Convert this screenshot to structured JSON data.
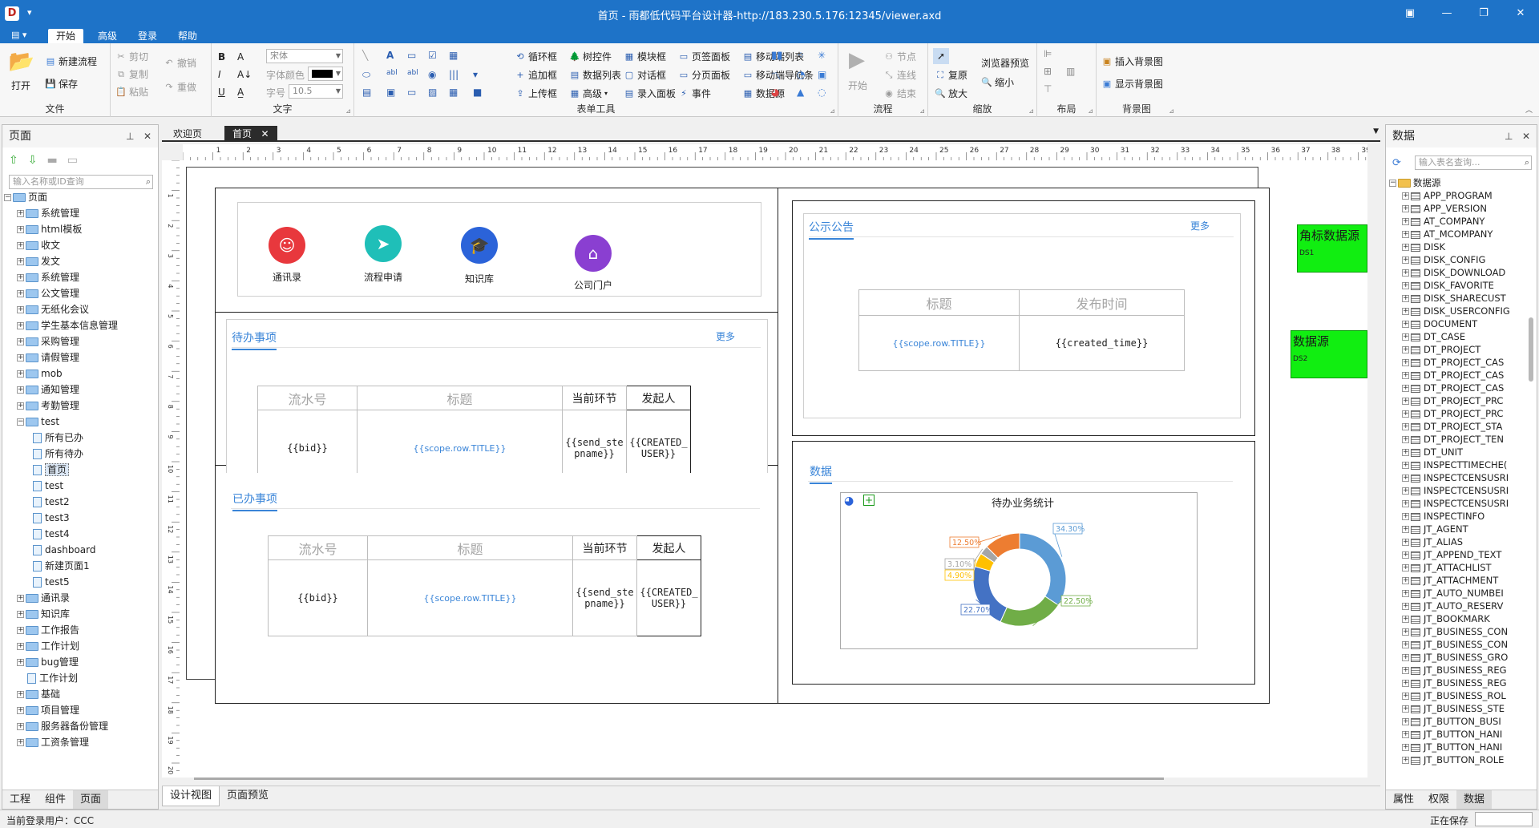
{
  "window": {
    "title": "首页 - 雨都低代码平台设计器-http://183.230.5.176:12345/viewer.axd",
    "app_icon": "D",
    "quick_access": "▾",
    "controls": [
      "▣",
      "—",
      "❐",
      "✕"
    ]
  },
  "menu": {
    "items": [
      "开始",
      "高级",
      "登录",
      "帮助"
    ],
    "active": "开始"
  },
  "ribbon": {
    "file": {
      "label": "文件",
      "open": "打开",
      "new_flow": "新建流程",
      "save": "保存"
    },
    "clipboard": {
      "cut": "剪切",
      "undo": "撤销",
      "copy": "复制",
      "paste": "粘贴",
      "redo": "重做"
    },
    "text": {
      "label": "文字",
      "font": "宋体",
      "font_color": "字体颜色",
      "font_size_label": "字号",
      "font_size": "10.5",
      "B": "B",
      "I": "I",
      "U": "U",
      "A": "A"
    },
    "form_tools": {
      "label": "表单工具",
      "items": [
        [
          "循环框",
          "树控件",
          "模块框",
          "页签面板",
          "移动端列表"
        ],
        [
          "追加框",
          "数据列表",
          "对话框",
          "分页面板",
          "移动端导航条"
        ],
        [
          "上传框",
          "高级",
          "录入面板",
          "事件",
          "数据源"
        ]
      ]
    },
    "flow": {
      "label": "流程",
      "start": "开始",
      "node": "节点",
      "connect": "连线",
      "end": "结束"
    },
    "zoom": {
      "label": "缩放",
      "browser_preview": "浏览器预览",
      "restore": "复原",
      "zoom_out": "缩小",
      "zoom_in": "放大"
    },
    "layout": {
      "label": "布局"
    },
    "background": {
      "label": "背景图",
      "insert": "插入背景图",
      "show": "显示背景图"
    }
  },
  "left_panel": {
    "title": "页面",
    "search_placeholder": "输入名称或ID查询",
    "root": "页面",
    "tree": [
      {
        "label": "系统管理",
        "type": "folder",
        "level": 1
      },
      {
        "label": "html模板",
        "type": "folder",
        "level": 1
      },
      {
        "label": "收文",
        "type": "folder",
        "level": 1
      },
      {
        "label": "发文",
        "type": "folder",
        "level": 1
      },
      {
        "label": "系统管理",
        "type": "folder",
        "level": 1
      },
      {
        "label": "公文管理",
        "type": "folder",
        "level": 1
      },
      {
        "label": "无纸化会议",
        "type": "folder",
        "level": 1
      },
      {
        "label": "学生基本信息管理",
        "type": "folder",
        "level": 1
      },
      {
        "label": "采购管理",
        "type": "folder",
        "level": 1
      },
      {
        "label": "请假管理",
        "type": "folder",
        "level": 1
      },
      {
        "label": "mob",
        "type": "folder",
        "level": 1
      },
      {
        "label": "通知管理",
        "type": "folder",
        "level": 1
      },
      {
        "label": "考勤管理",
        "type": "folder",
        "level": 1
      },
      {
        "label": "test",
        "type": "folder",
        "level": 1,
        "open": true
      },
      {
        "label": "所有已办",
        "type": "page",
        "level": 2
      },
      {
        "label": "所有待办",
        "type": "page",
        "level": 2
      },
      {
        "label": "首页",
        "type": "page",
        "level": 2,
        "selected": true
      },
      {
        "label": "test",
        "type": "page",
        "level": 2
      },
      {
        "label": "test2",
        "type": "page",
        "level": 2
      },
      {
        "label": "test3",
        "type": "page",
        "level": 2
      },
      {
        "label": "test4",
        "type": "page",
        "level": 2
      },
      {
        "label": "dashboard",
        "type": "page",
        "level": 2
      },
      {
        "label": "新建页面1",
        "type": "page",
        "level": 2
      },
      {
        "label": "test5",
        "type": "page",
        "level": 2
      },
      {
        "label": "通讯录",
        "type": "folder",
        "level": 1
      },
      {
        "label": "知识库",
        "type": "folder",
        "level": 1
      },
      {
        "label": "工作报告",
        "type": "folder",
        "level": 1
      },
      {
        "label": "工作计划",
        "type": "folder",
        "level": 1
      },
      {
        "label": "bug管理",
        "type": "folder",
        "level": 1
      },
      {
        "label": "工作计划",
        "type": "page",
        "level": 1
      },
      {
        "label": "基础",
        "type": "folder",
        "level": 1
      },
      {
        "label": "项目管理",
        "type": "folder",
        "level": 1
      },
      {
        "label": "服务器备份管理",
        "type": "folder",
        "level": 1
      },
      {
        "label": "工资条管理",
        "type": "folder",
        "level": 1
      }
    ],
    "tabs": [
      "工程",
      "组件",
      "页面"
    ],
    "active_tab": "页面"
  },
  "doc_tabs": {
    "welcome": "欢迎页",
    "home": "首页",
    "close": "✕"
  },
  "ruler": {
    "numbers": [
      "1",
      "2",
      "3",
      "4",
      "5",
      "6",
      "7",
      "8",
      "9",
      "10",
      "11",
      "12",
      "13",
      "14",
      "15",
      "16",
      "17",
      "18",
      "19",
      "20",
      "21",
      "22",
      "23",
      "24",
      "25",
      "26",
      "27",
      "28",
      "29",
      "30",
      "31",
      "32",
      "33",
      "34",
      "35",
      "36",
      "37",
      "38",
      "39"
    ],
    "v_numbers": [
      "1",
      "2",
      "3",
      "4",
      "5",
      "6",
      "7",
      "8",
      "9",
      "10",
      "11",
      "12",
      "13",
      "14",
      "15",
      "16",
      "17",
      "18",
      "19",
      "20"
    ]
  },
  "design": {
    "shortcuts": [
      {
        "label": "通讯录",
        "color": "#e8383d",
        "glyph": "☺"
      },
      {
        "label": "流程申请",
        "color": "#1fbfb8",
        "glyph": "➤"
      },
      {
        "label": "知识库",
        "color": "#2b63d9",
        "glyph": "🎓"
      },
      {
        "label": "公司门户",
        "color": "#8a3fd1",
        "glyph": "⌂"
      }
    ],
    "todo": {
      "title": "待办事项",
      "more": "更多",
      "headers": [
        "流水号",
        "标题",
        "当前环节",
        "发起人"
      ],
      "cells": [
        "{{bid}}",
        "{{scope.row.TITLE}}",
        "{{send_ste pname}}",
        "{{CREATED_ USER}}"
      ]
    },
    "done": {
      "title": "已办事项",
      "headers": [
        "流水号",
        "标题",
        "当前环节",
        "发起人"
      ],
      "cells": [
        "{{bid}}",
        "{{scope.row.TITLE}}",
        "{{send_ste pname}}",
        "{{CREATED_ USER}}"
      ]
    },
    "notice": {
      "title": "公示公告",
      "more": "更多",
      "headers": [
        "标题",
        "发布时间"
      ],
      "cells": [
        "{{scope.row.TITLE}}",
        "{{created_time}}"
      ]
    },
    "data": {
      "title": "数据"
    }
  },
  "chart_data": {
    "type": "pie",
    "title": "待办业务统计",
    "donut": true,
    "labels": [
      "34.30%",
      "22.50%",
      "22.70%",
      "4.90%",
      "3.10%",
      "12.50%"
    ],
    "values": [
      34.3,
      22.5,
      22.7,
      4.9,
      3.1,
      12.5
    ],
    "colors": [
      "#5b9bd5",
      "#70ad47",
      "#4472c4",
      "#ffc000",
      "#a5a5a5",
      "#ed7d31"
    ]
  },
  "datasources": [
    {
      "title": "角标数据源",
      "id": "DS1"
    },
    {
      "title": "数据源",
      "id": "DS2"
    }
  ],
  "bottom_tabs": {
    "design": "设计视图",
    "preview": "页面预览"
  },
  "right_panel": {
    "title": "数据",
    "search_placeholder": "输入表名查询...",
    "root": "数据源",
    "tables": [
      "APP_PROGRAM",
      "APP_VERSION",
      "AT_COMPANY",
      "AT_MCOMPANY",
      "DISK",
      "DISK_CONFIG",
      "DISK_DOWNLOAD",
      "DISK_FAVORITE",
      "DISK_SHARECUST",
      "DISK_USERCONFIG",
      "DOCUMENT",
      "DT_CASE",
      "DT_PROJECT",
      "DT_PROJECT_CAS",
      "DT_PROJECT_CAS",
      "DT_PROJECT_CAS",
      "DT_PROJECT_PRC",
      "DT_PROJECT_PRC",
      "DT_PROJECT_STA",
      "DT_PROJECT_TEN",
      "DT_UNIT",
      "INSPECTTIMECHE(",
      "INSPECTCENSUSRI",
      "INSPECTCENSUSRI",
      "INSPECTCENSUSRI",
      "INSPECTINFO",
      "JT_AGENT",
      "JT_ALIAS",
      "JT_APPEND_TEXT",
      "JT_ATTACHLIST",
      "JT_ATTACHMENT",
      "JT_AUTO_NUMBEI",
      "JT_AUTO_RESERV",
      "JT_BOOKMARK",
      "JT_BUSINESS_CON",
      "JT_BUSINESS_CON",
      "JT_BUSINESS_GRO",
      "JT_BUSINESS_REG",
      "JT_BUSINESS_REG",
      "JT_BUSINESS_ROL",
      "JT_BUSINESS_STE",
      "JT_BUTTON_BUSI",
      "JT_BUTTON_HANI",
      "JT_BUTTON_HANI",
      "JT_BUTTON_ROLE"
    ],
    "tabs": [
      "属性",
      "权限",
      "数据"
    ],
    "active_tab": "数据"
  },
  "status": {
    "user": "当前登录用户：CCC",
    "saving": "正在保存"
  }
}
